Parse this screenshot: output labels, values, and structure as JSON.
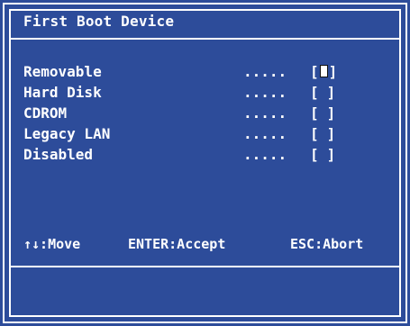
{
  "dialog": {
    "title": "First Boot Device",
    "options": [
      {
        "label": "Removable",
        "dots": ".....",
        "box_open": "[",
        "box_close": "]",
        "selected": true
      },
      {
        "label": "Hard Disk",
        "dots": ".....",
        "box_open": "[",
        "box_close": "]",
        "selected": false
      },
      {
        "label": "CDROM",
        "dots": ".....",
        "box_open": "[",
        "box_close": "]",
        "selected": false
      },
      {
        "label": "Legacy LAN",
        "dots": ".....",
        "box_open": "[",
        "box_close": "]",
        "selected": false
      },
      {
        "label": "Disabled",
        "dots": ".....",
        "box_open": "[",
        "box_close": "]",
        "selected": false
      }
    ],
    "help": {
      "move": "↑↓:Move",
      "accept": "ENTER:Accept",
      "abort": "ESC:Abort"
    }
  },
  "colors": {
    "background": "#2d4c9a",
    "text": "#ffffff",
    "frame": "#ffffff"
  }
}
